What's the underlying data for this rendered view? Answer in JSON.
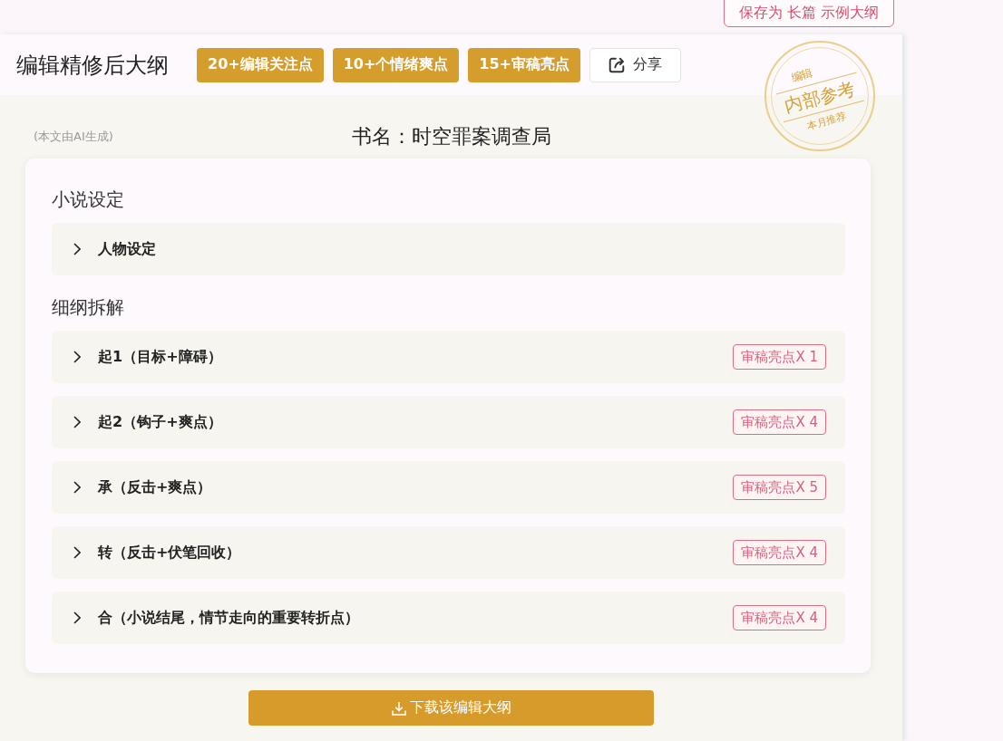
{
  "save_button": {
    "label": "保存为 长篇 示例大纲"
  },
  "header": {
    "title": "编辑精修后大纲",
    "tags": [
      "20+编辑关注点",
      "10+个情绪爽点",
      "15+审稿亮点"
    ],
    "share_button": {
      "label": "分享"
    }
  },
  "stamp": {
    "top": "编辑",
    "middle": "内部参考",
    "bottom": "本月推荐"
  },
  "ai_note": "(本文由AI生成)",
  "book_title": "书名：时空罪案调查局",
  "sections": [
    {
      "heading": "小说设定",
      "items": [
        {
          "label": "人物设定",
          "expanded": false
        }
      ]
    },
    {
      "heading": "细纲拆解",
      "items": [
        {
          "label": "起1（目标+障碍）",
          "expanded": false,
          "badge": "审稿亮点X 1"
        },
        {
          "label": "起2（钩子+爽点）",
          "expanded": false,
          "badge": "审稿亮点X 4"
        },
        {
          "label": "承（反击+爽点）",
          "expanded": false,
          "badge": "审稿亮点X 5"
        },
        {
          "label": "转（反击+伏笔回收）",
          "expanded": false,
          "badge": "审稿亮点X 4"
        },
        {
          "label": "合（小说结尾，情节走向的重要转折点）",
          "expanded": false,
          "badge": "审稿亮点X 4"
        }
      ]
    }
  ],
  "download_button": {
    "label": "下载该编辑大纲"
  }
}
